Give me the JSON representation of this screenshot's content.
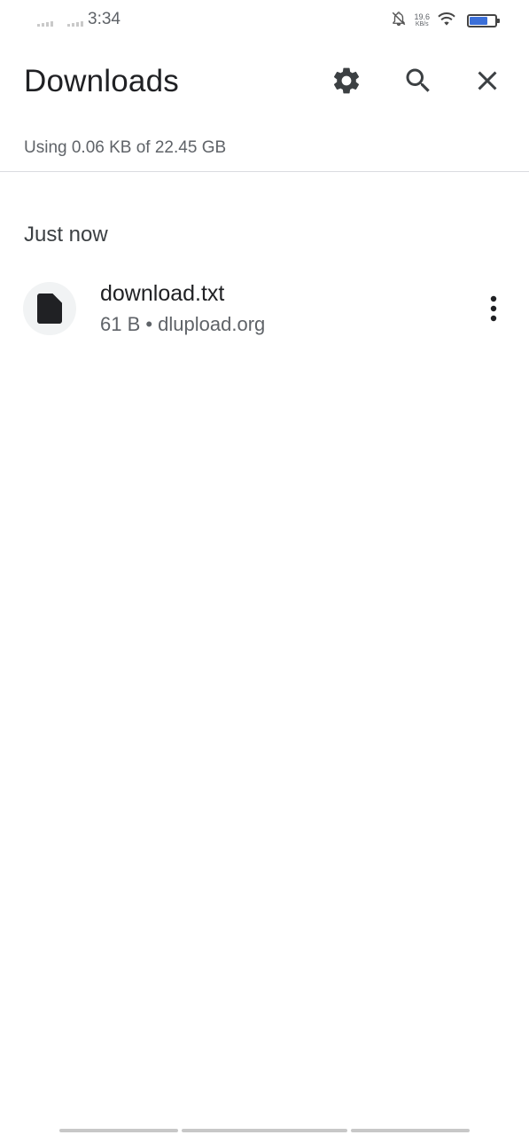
{
  "status_bar": {
    "time": "3:34",
    "net_speed_value": "19.6",
    "net_speed_unit": "KB/s",
    "icons": [
      "signal-icon",
      "notifications-off-icon",
      "wifi-icon",
      "battery-icon"
    ]
  },
  "header": {
    "title": "Downloads",
    "icons": {
      "settings": "gear-icon",
      "search": "search-icon",
      "close": "close-icon"
    }
  },
  "storage": {
    "text": "Using 0.06 KB of 22.45 GB"
  },
  "sections": [
    {
      "header": "Just now",
      "items": [
        {
          "name": "download.txt",
          "meta": "61 B • dlupload.org",
          "icon": "file-icon"
        }
      ]
    }
  ],
  "colors": {
    "text_primary": "#202124",
    "text_secondary": "#5f6368",
    "divider": "#dadce0",
    "icon_bg": "#f1f3f4"
  }
}
